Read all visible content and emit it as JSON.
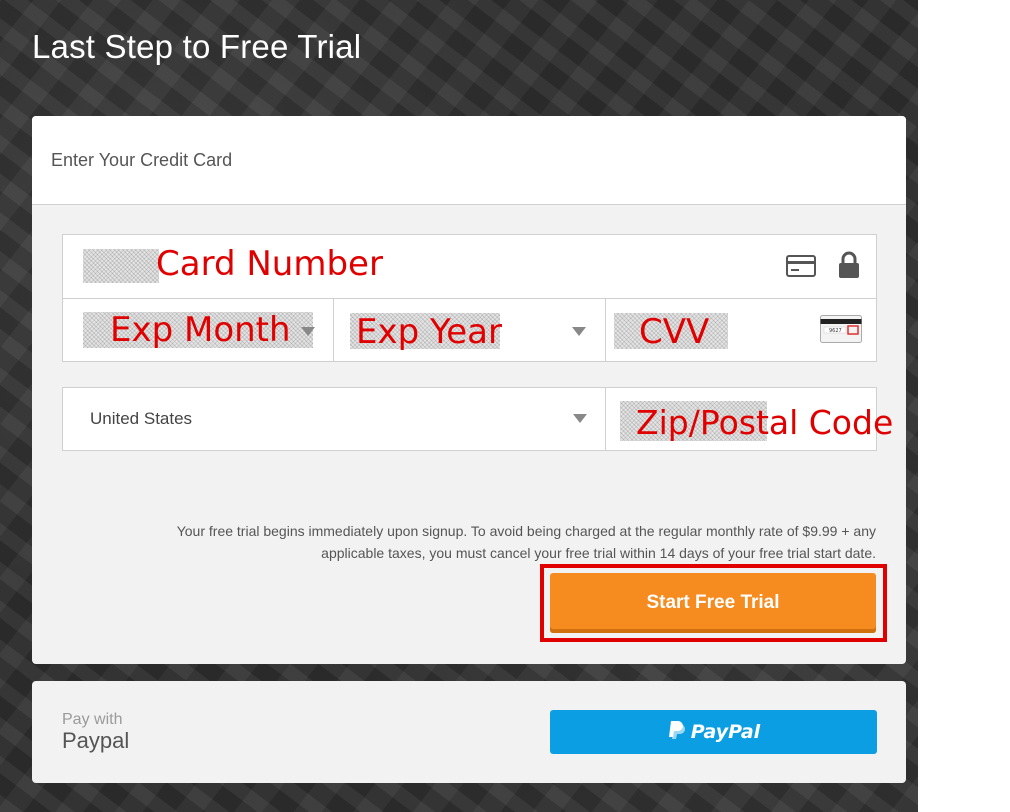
{
  "page": {
    "title": "Last Step to Free Trial"
  },
  "form": {
    "header": "Enter Your Credit Card",
    "card_number": {
      "label": "Card Number",
      "icons": [
        "credit-card-icon",
        "lock-icon"
      ]
    },
    "exp_month": {
      "label": "Exp Month"
    },
    "exp_year": {
      "label": "Exp Year"
    },
    "cvv": {
      "label": "CVV",
      "icon": "cvv-card-icon",
      "card_digits": "9627"
    },
    "country": {
      "value": "United States"
    },
    "zip": {
      "label": "Zip/Postal Code"
    },
    "disclaimer": "Your free trial begins immediately upon signup. To avoid being charged at the regular monthly rate of $9.99 + any applicable taxes, you must cancel your free trial within 14 days of your free trial start date.",
    "submit_label": "Start Free Trial"
  },
  "paypal": {
    "pay_with": "Pay with",
    "name": "Paypal",
    "button_label": "PayPal"
  },
  "colors": {
    "accent_orange": "#f68b1f",
    "annotation_red": "#e00000",
    "paypal_blue": "#0c9ee2"
  }
}
